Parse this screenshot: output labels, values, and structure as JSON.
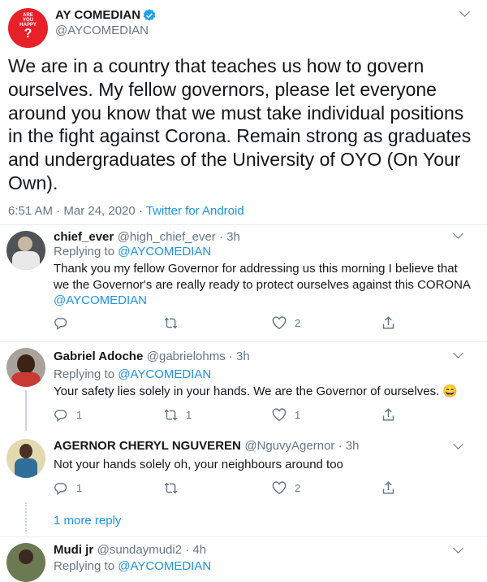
{
  "main_tweet": {
    "author_name": "AY COMEDIAN",
    "handle": "@AYCOMEDIAN",
    "avatar_text": [
      "ARE",
      "YOU",
      "HAPPY",
      "?"
    ],
    "text": "We are in a country that teaches us how to govern ourselves. My fellow governors, please let everyone around you know that we must take individual positions in the fight against Corona. Remain strong as graduates and undergraduates of the University of OYO (On Your Own).",
    "timestamp": "6:51 AM · Mar 24, 2020 · ",
    "source": "Twitter for Android"
  },
  "replies": [
    {
      "name": "chief_ever",
      "handle": "@high_chief_ever · 3h",
      "replying_label": "Replying to ",
      "replying_to": "@AYCOMEDIAN",
      "text": "Thank you my fellow Governor for addressing us this morning I believe that we the Governor's are really ready to protect ourselves against this CORONA",
      "mention": "@AYCOMEDIAN",
      "reply_count": "",
      "retweet_count": "",
      "like_count": "2"
    },
    {
      "name": "Gabriel Adoche",
      "handle": "@gabrielohms · 3h",
      "replying_label": "Replying to ",
      "replying_to": "@AYCOMEDIAN",
      "text": "Your safety lies solely in your hands. We are the Governor of ourselves. 😄",
      "reply_count": "1",
      "retweet_count": "1",
      "like_count": "1"
    },
    {
      "name": "AGERNOR CHERYL NGUVEREN",
      "handle": "@NguvyAgernor · 3h",
      "text": "Not your hands solely oh, your neighbours around too",
      "reply_count": "1",
      "retweet_count": "",
      "like_count": "2"
    },
    {
      "name": "Mudi jr",
      "handle": "@sundaymudi2 · 4h",
      "replying_label": "Replying to ",
      "replying_to": "@AYCOMEDIAN"
    }
  ],
  "more_replies": "1 more reply",
  "colors": {
    "link": "#1b95e0",
    "secondary": "#657786",
    "verified": "#1da1f2",
    "divider": "#e6ecf0",
    "avatar_red": "#e8202a"
  }
}
